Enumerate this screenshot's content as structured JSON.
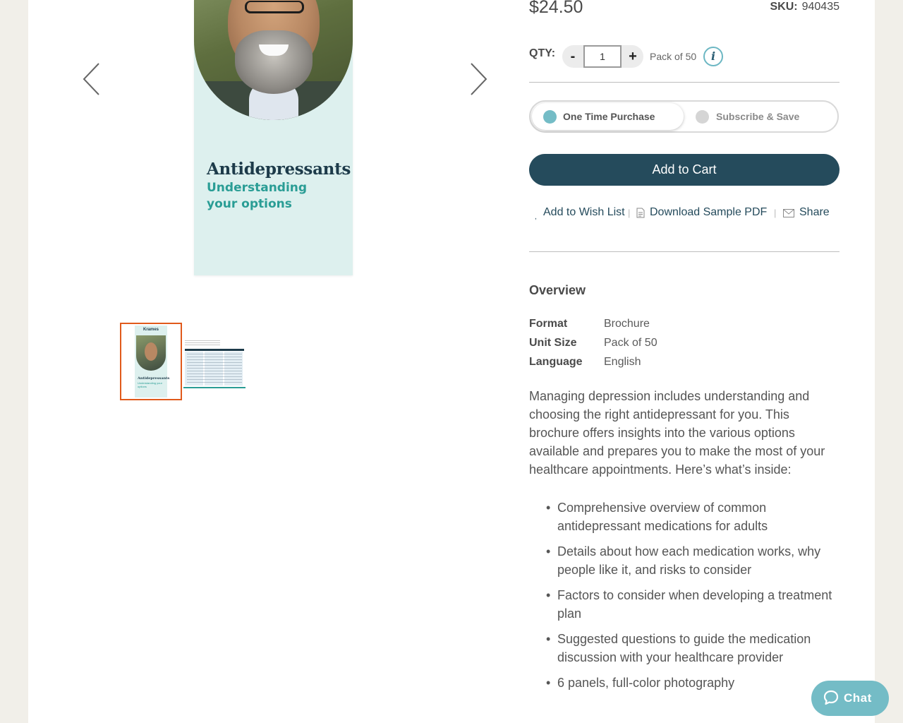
{
  "gallery": {
    "cover_title": "Antidepressants",
    "cover_subtitle": "Understanding your options",
    "thumb_logo": "Krames",
    "thumb_title": "Antidepressants",
    "thumb_subtitle": "Understanding your options",
    "prev_icon": "chevron-left-icon",
    "next_icon": "chevron-right-icon",
    "selected_thumb_border": "#e05a1c"
  },
  "product": {
    "price": "$24.50",
    "sku_label": "SKU:",
    "sku_value": "940435"
  },
  "quantity": {
    "label": "QTY:",
    "minus": "-",
    "plus": "+",
    "value": "1",
    "pack": "Pack of 50",
    "info": "i"
  },
  "purchase_options": {
    "one_time": "One Time Purchase",
    "subscribe": "Subscribe & Save",
    "selected": "One Time Purchase"
  },
  "add_to_cart": "Add to Cart",
  "links": {
    "dot": ",",
    "wishlist": "Add to Wish List",
    "sep": "|",
    "sample_pdf": "Download Sample PDF",
    "share": "Share"
  },
  "overview": {
    "heading": "Overview",
    "specs": [
      {
        "key": "Format",
        "value": "Brochure"
      },
      {
        "key": "Unit Size",
        "value": "Pack of 50"
      },
      {
        "key": "Language",
        "value": "English"
      }
    ],
    "description": "Managing depression includes understanding and choosing the right antidepressant for you. This brochure offers insights into the various options available and prepares you to make the most of your healthcare appointments. Here’s what’s inside:",
    "bullets": [
      "Comprehensive overview of common antidepressant medications for adults",
      "Details about how each medication works, why people like it, and risks to consider",
      "Factors to consider when developing a treatment plan",
      "Suggested questions to guide the medication discussion with your healthcare provider",
      "6 panels, full-color photography"
    ]
  },
  "chat": {
    "label": "Chat"
  },
  "colors": {
    "primary": "#254b5c",
    "accent": "#74bcc6",
    "teal_text": "#2a9d95",
    "page_bg": "#f1efe9"
  }
}
